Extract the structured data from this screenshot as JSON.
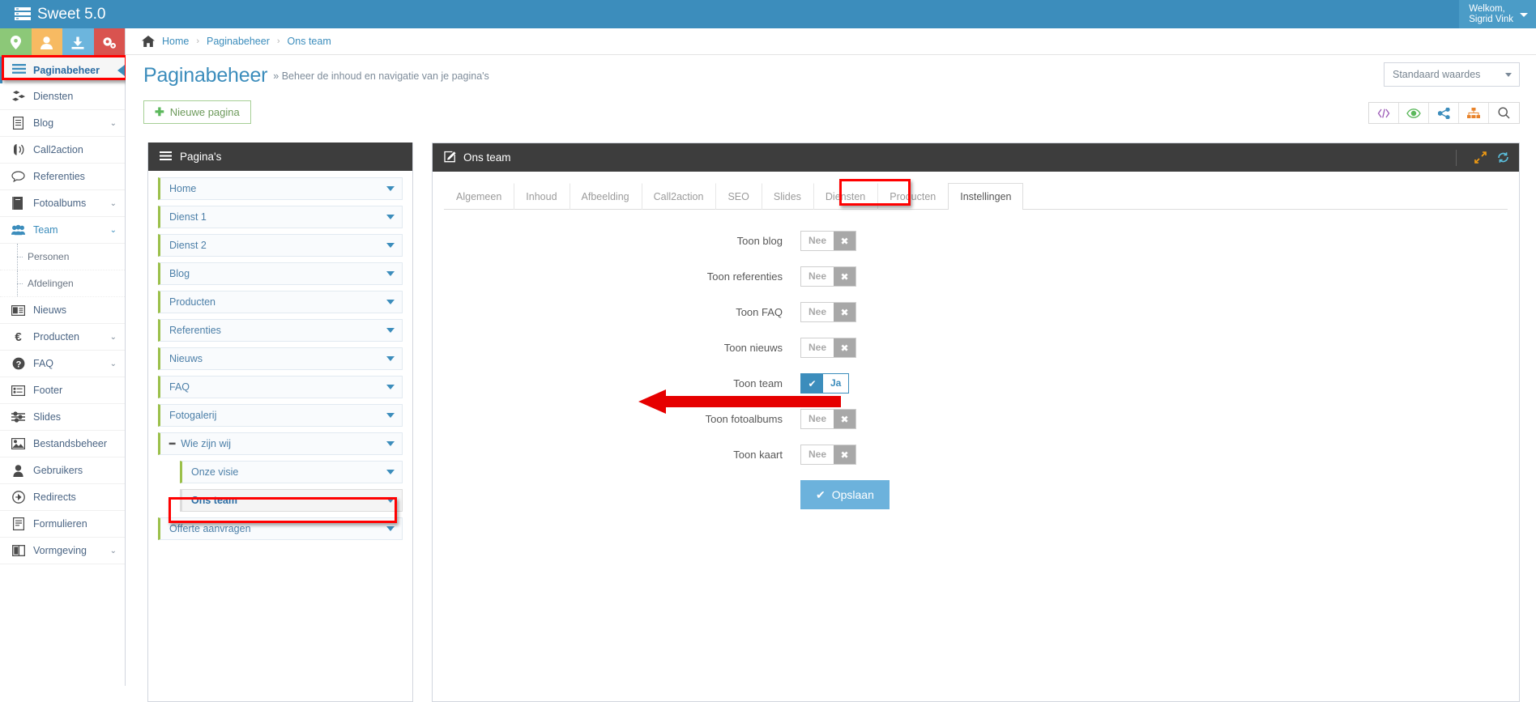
{
  "topbar": {
    "brand": "Sweet 5.0",
    "brand_icon": "server-stack-icon",
    "welcome_line1": "Welkom,",
    "welcome_line2": "Sigrid Vink"
  },
  "quick_actions": [
    {
      "name": "location-pin-icon",
      "color": "#8cc878"
    },
    {
      "name": "user-icon",
      "color": "#f7ba62"
    },
    {
      "name": "download-icon",
      "color": "#6cb5dd"
    },
    {
      "name": "gears-icon",
      "color": "#d9534f"
    }
  ],
  "sidebar": {
    "active_item": {
      "label": "Paginabeheer",
      "icon": "hamburger-icon"
    },
    "items": [
      {
        "label": "Diensten",
        "icon": "cubes-icon",
        "chevron": false
      },
      {
        "label": "Blog",
        "icon": "document-icon",
        "chevron": true
      },
      {
        "label": "Call2action",
        "icon": "bullhorn-icon",
        "chevron": false
      },
      {
        "label": "Referenties",
        "icon": "comment-icon",
        "chevron": false
      },
      {
        "label": "Fotoalbums",
        "icon": "book-icon",
        "chevron": true
      },
      {
        "label": "Team",
        "icon": "users-icon",
        "chevron": true,
        "active": true
      },
      {
        "label": "Personen",
        "icon": "",
        "chevron": false,
        "sub": true
      },
      {
        "label": "Afdelingen",
        "icon": "",
        "chevron": false,
        "sub": true
      },
      {
        "label": "Nieuws",
        "icon": "newspaper-icon",
        "chevron": false
      },
      {
        "label": "Producten",
        "icon": "euro-icon",
        "chevron": true
      },
      {
        "label": "FAQ",
        "icon": "question-icon",
        "chevron": true
      },
      {
        "label": "Footer",
        "icon": "list-icon",
        "chevron": false
      },
      {
        "label": "Slides",
        "icon": "sliders-icon",
        "chevron": false
      },
      {
        "label": "Bestandsbeheer",
        "icon": "image-icon",
        "chevron": false
      },
      {
        "label": "Gebruikers",
        "icon": "person-icon",
        "chevron": false
      },
      {
        "label": "Redirects",
        "icon": "arrow-circle-icon",
        "chevron": false
      },
      {
        "label": "Formulieren",
        "icon": "form-icon",
        "chevron": false
      },
      {
        "label": "Vormgeving",
        "icon": "layout-icon",
        "chevron": true
      }
    ]
  },
  "breadcrumb": {
    "home_icon": "home-icon",
    "items": [
      "Home",
      "Paginabeheer",
      "Ons team"
    ],
    "separator": "›"
  },
  "page_header": {
    "title": "Paginabeheer",
    "subtitle": "» Beheer de inhoud en navigatie van je pagina's",
    "select_value": "Standaard waardes"
  },
  "toolbar": {
    "new_page_label": "Nieuwe pagina",
    "new_page_icon": "plus-icon",
    "icons": [
      {
        "name": "code-icon",
        "glyph": "</>",
        "color": "#9b59b6"
      },
      {
        "name": "eye-icon",
        "glyph": "◉",
        "color": "#5cb85c"
      },
      {
        "name": "share-icon",
        "glyph": "⁂",
        "color": "#3c8dbc"
      },
      {
        "name": "sitemap-icon",
        "glyph": "⚒",
        "color": "#e8832a"
      },
      {
        "name": "search-icon",
        "glyph": "🔍",
        "color": "#555555"
      }
    ]
  },
  "pages_panel": {
    "title": "Pagina's",
    "title_icon": "hamburger-icon",
    "tree": [
      {
        "label": "Home",
        "indent": false,
        "selected": false,
        "collapse": false
      },
      {
        "label": "Dienst 1",
        "indent": false,
        "selected": false,
        "collapse": false
      },
      {
        "label": "Dienst 2",
        "indent": false,
        "selected": false,
        "collapse": false
      },
      {
        "label": "Blog",
        "indent": false,
        "selected": false,
        "collapse": false
      },
      {
        "label": "Producten",
        "indent": false,
        "selected": false,
        "collapse": false
      },
      {
        "label": "Referenties",
        "indent": false,
        "selected": false,
        "collapse": false
      },
      {
        "label": "Nieuws",
        "indent": false,
        "selected": false,
        "collapse": false
      },
      {
        "label": "FAQ",
        "indent": false,
        "selected": false,
        "collapse": false
      },
      {
        "label": "Fotogalerij",
        "indent": false,
        "selected": false,
        "collapse": false
      },
      {
        "label": "Wie zijn wij",
        "indent": false,
        "selected": false,
        "collapse": true
      },
      {
        "label": "Onze visie",
        "indent": true,
        "selected": false,
        "collapse": false
      },
      {
        "label": "Ons team",
        "indent": true,
        "selected": true,
        "collapse": false
      },
      {
        "label": "Offerte aanvragen",
        "indent": false,
        "selected": false,
        "collapse": false
      }
    ]
  },
  "content_panel": {
    "title": "Ons team",
    "title_icon": "edit-square-icon",
    "header_icons": [
      {
        "name": "expand-icon",
        "glyph": "↗",
        "color": "#f39c12"
      },
      {
        "name": "refresh-icon",
        "glyph": "↻",
        "color": "#5bc0de"
      }
    ],
    "tabs": [
      {
        "label": "Algemeen",
        "active": false
      },
      {
        "label": "Inhoud",
        "active": false
      },
      {
        "label": "Afbeelding",
        "active": false
      },
      {
        "label": "Call2action",
        "active": false
      },
      {
        "label": "SEO",
        "active": false
      },
      {
        "label": "Slides",
        "active": false
      },
      {
        "label": "Diensten",
        "active": false
      },
      {
        "label": "Producten",
        "active": false
      },
      {
        "label": "Instellingen",
        "active": true
      }
    ],
    "settings": [
      {
        "label": "Toon blog",
        "value": "Nee",
        "on": false
      },
      {
        "label": "Toon referenties",
        "value": "Nee",
        "on": false
      },
      {
        "label": "Toon FAQ",
        "value": "Nee",
        "on": false
      },
      {
        "label": "Toon nieuws",
        "value": "Nee",
        "on": false
      },
      {
        "label": "Toon team",
        "value": "Ja",
        "on": true
      },
      {
        "label": "Toon fotoalbums",
        "value": "Nee",
        "on": false
      },
      {
        "label": "Toon kaart",
        "value": "Nee",
        "on": false
      }
    ],
    "save_label": "Opslaan",
    "save_icon": "check-icon"
  },
  "annotations": {
    "highlight_color": "#ff0000",
    "targets": [
      "sidebar-paginabeheer",
      "tree-ons-team",
      "tab-instellingen",
      "toggle-toon-team"
    ]
  }
}
